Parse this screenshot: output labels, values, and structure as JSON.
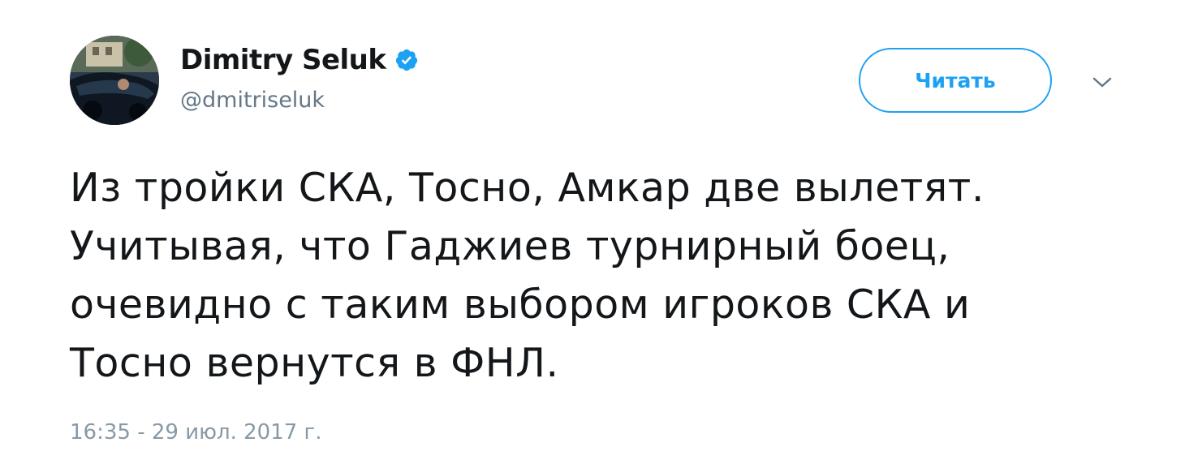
{
  "author": {
    "display_name": "Dimitry Seluk",
    "handle": "@dmitriseluk",
    "verified": true
  },
  "follow_button": {
    "label": "Читать"
  },
  "tweet": {
    "lines": [
      "Из тройки СКА, Тосно, Амкар две вылетят.",
      "Учитывая, что Гаджиев турнирный боец,",
      "очевидно с таким выбором игроков СКА и",
      "Тосно вернутся в ФНЛ."
    ],
    "timestamp": "16:35 - 29 июл. 2017 г."
  },
  "icons": {
    "verified": "verified-badge-icon",
    "menu": "chevron-down-icon"
  },
  "colors": {
    "accent": "#1da1f2",
    "text": "#14171a",
    "secondary": "#657786",
    "timestamp": "#8899a6"
  }
}
